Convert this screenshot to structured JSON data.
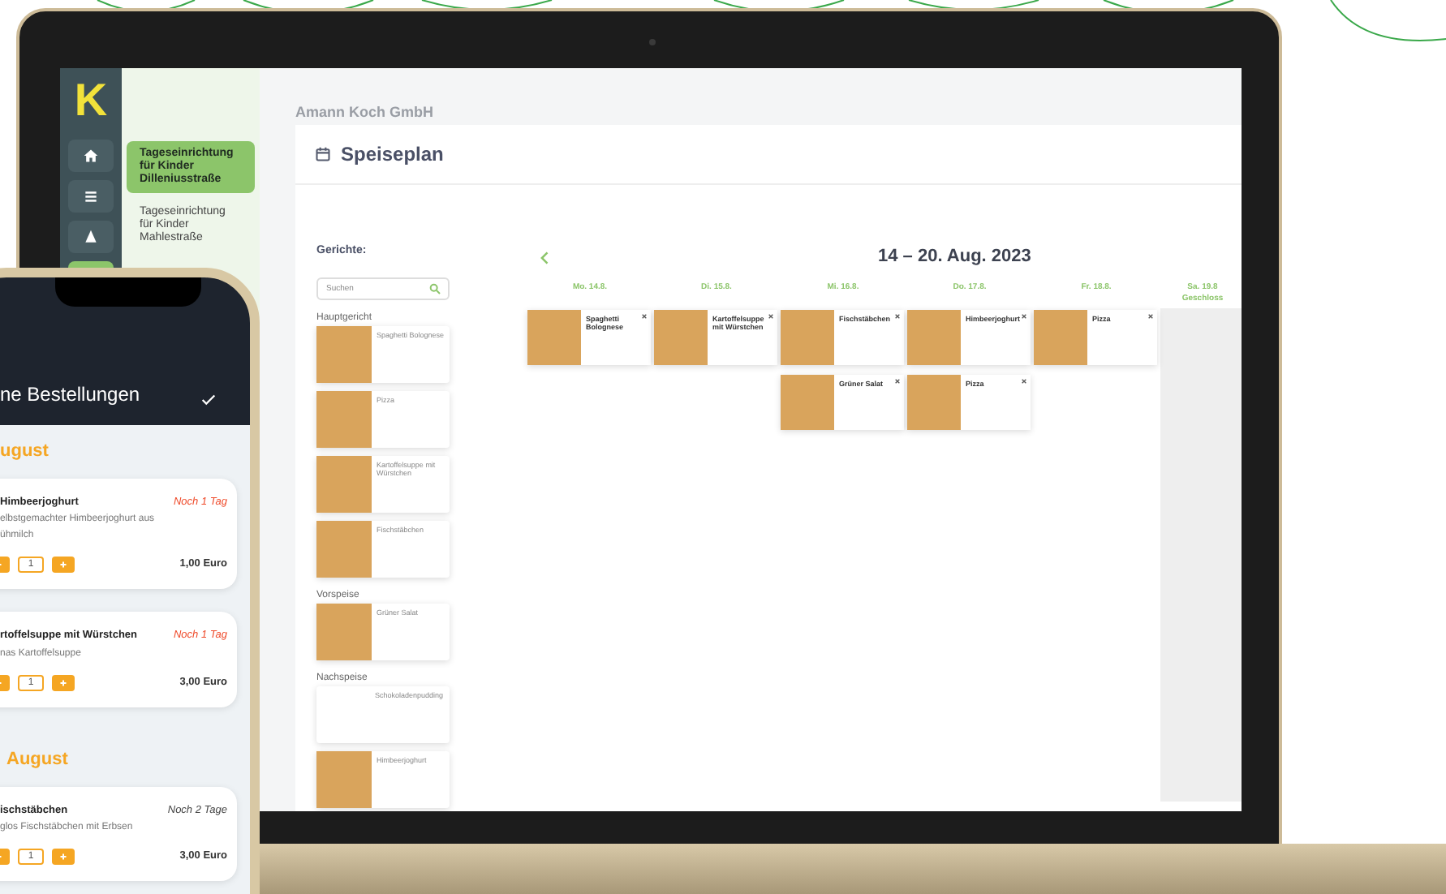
{
  "laptop": {
    "logo": "K",
    "icon_nav": [
      {
        "kind": "home",
        "selected": false
      },
      {
        "kind": "list",
        "selected": false
      },
      {
        "kind": "tree",
        "selected": false
      },
      {
        "selected": true
      }
    ],
    "locations": [
      {
        "label": "Tageseinrichtung für Kinder Dilleniusstraße",
        "selected": true
      },
      {
        "label": "Tageseinrichtung für Kinder Mahlestraße",
        "selected": false
      }
    ],
    "company": "Amann Koch GmbH",
    "page_title": "Speiseplan",
    "dishes": {
      "title": "Gerichte:",
      "search_placeholder": "Suchen",
      "categories": [
        {
          "name": "Hauptgericht",
          "items": [
            {
              "name": "Spaghetti Bolognese",
              "photo": true
            },
            {
              "name": "Pizza",
              "photo": true
            },
            {
              "name": "Kartoffelsuppe mit Würstchen",
              "photo": true
            },
            {
              "name": "Fischstäbchen",
              "photo": true
            }
          ]
        },
        {
          "name": "Vorspeise",
          "items": [
            {
              "name": "Grüner Salat",
              "photo": true
            }
          ]
        },
        {
          "name": "Nachspeise",
          "items": [
            {
              "name": "Schokoladenpudding",
              "photo": false
            },
            {
              "name": "Himbeerjoghurt",
              "photo": true
            }
          ]
        }
      ]
    },
    "week": {
      "range": "14 – 20. Aug. 2023",
      "days": [
        {
          "label": "Mo. 14.8.",
          "closed": false,
          "meals": [
            {
              "name": "Spaghetti Bolognese"
            }
          ]
        },
        {
          "label": "Di. 15.8.",
          "closed": false,
          "meals": [
            {
              "name": "Kartoffelsuppe mit Würstchen"
            }
          ]
        },
        {
          "label": "Mi. 16.8.",
          "closed": false,
          "meals": [
            {
              "name": "Fischstäbchen"
            },
            {
              "name": "Grüner Salat"
            }
          ]
        },
        {
          "label": "Do. 17.8.",
          "closed": false,
          "meals": [
            {
              "name": "Himbeerjoghurt"
            },
            {
              "name": "Pizza"
            }
          ]
        },
        {
          "label": "Fr. 18.8.",
          "closed": false,
          "meals": [
            {
              "name": "Pizza"
            }
          ]
        },
        {
          "label": "Sa. 19.8",
          "note": "Geschloss",
          "closed": true
        }
      ]
    }
  },
  "phone": {
    "title": "ne Bestellungen",
    "groups": [
      {
        "heading": "ugust",
        "orders": [
          {
            "name": "Himbeerjoghurt",
            "due": "Noch 1 Tag",
            "urgent": true,
            "description": [
              "elbstgemachter Himbeerjoghurt aus",
              "ühmilch"
            ],
            "quantity": "1",
            "price": "1,00 Euro"
          },
          {
            "name": "rtoffelsuppe mit Würstchen",
            "due": "Noch 1 Tag",
            "urgent": true,
            "description": [
              "nas Kartoffelsuppe"
            ],
            "quantity": "1",
            "price": "3,00 Euro"
          }
        ]
      },
      {
        "heading": "August",
        "orders": [
          {
            "name": "ischstäbchen",
            "due": "Noch 2 Tage",
            "urgent": false,
            "description": [
              "glos Fischstäbchen mit Erbsen"
            ],
            "quantity": "1",
            "price": "3,00 Euro"
          }
        ]
      }
    ]
  }
}
